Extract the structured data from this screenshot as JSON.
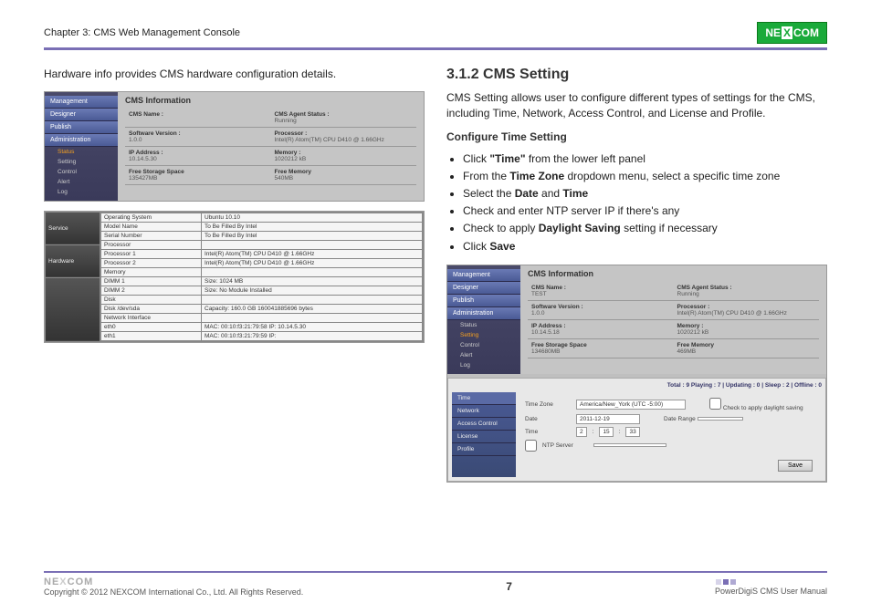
{
  "header": {
    "chapter": "Chapter 3: CMS Web Management Console",
    "logo": "NEXCOM"
  },
  "left": {
    "intro": "Hardware info provides CMS hardware configuration details.",
    "ss1": {
      "nav": [
        "Management",
        "Designer",
        "Publish",
        "Administration"
      ],
      "sub": [
        "Status",
        "Setting",
        "Control",
        "Alert",
        "Log"
      ],
      "title": "CMS Information",
      "info": [
        {
          "l": "CMS Name :",
          "v": ""
        },
        {
          "l": "CMS Agent Status :",
          "v": "Running"
        },
        {
          "l": "Software Version :",
          "v": "1.0.0"
        },
        {
          "l": "Processor :",
          "v": "Intel(R) Atom(TM) CPU D410 @ 1.66GHz"
        },
        {
          "l": "IP Address :",
          "v": "10.14.5.30"
        },
        {
          "l": "Memory :",
          "v": "1020212 kB"
        },
        {
          "l": "Free Storage Space",
          "v": "135427MB"
        },
        {
          "l": "Free Memory",
          "v": "540MB"
        }
      ],
      "hwTabs": [
        "Service",
        "Hardware"
      ],
      "hw": [
        [
          "Operating System",
          "Ubuntu 10.10"
        ],
        [
          "Model Name",
          "To Be Filled By Intel"
        ],
        [
          "Serial Number",
          "To Be Filled By Intel"
        ],
        [
          "Processor",
          ""
        ],
        [
          "Processor 1",
          "Intel(R) Atom(TM) CPU D410 @ 1.66GHz"
        ],
        [
          "Processor 2",
          "Intel(R) Atom(TM) CPU D410 @ 1.66GHz"
        ],
        [
          "Memory",
          ""
        ],
        [
          "DIMM 1",
          "Size: 1024 MB"
        ],
        [
          "DIMM 2",
          "Size: No Module Installed"
        ],
        [
          "Disk",
          ""
        ],
        [
          "Disk /dev/sda",
          "Capacity: 160.0 GB  160041885696 bytes"
        ],
        [
          "Network Interface",
          ""
        ],
        [
          "eth0",
          "MAC: 00:10:f3:21:79:58  IP: 10.14.5.30"
        ],
        [
          "eth1",
          "MAC: 00:10:f3:21:79:59  IP:"
        ]
      ]
    }
  },
  "right": {
    "h2": "3.1.2 CMS Setting",
    "para": "CMS Setting allows user to configure different types of settings for the CMS, including Time, Network, Access Control, and License and Profile.",
    "h3": "Configure Time Setting",
    "bullets": [
      {
        "pre": "Click ",
        "b": "\"Time\"",
        "post": " from the lower left panel"
      },
      {
        "pre": "From the ",
        "b": "Time Zone",
        "post": " dropdown menu, select a specific time zone"
      },
      {
        "pre": "Select the ",
        "b": "Date",
        "post": " and ",
        "b2": "Time"
      },
      {
        "pre": "Check and enter NTP server IP if there's any"
      },
      {
        "pre": "Check to apply ",
        "b": "Daylight Saving",
        "post": " setting if necessary"
      },
      {
        "pre": "Click ",
        "b": "Save"
      }
    ],
    "ss2": {
      "nav": [
        "Management",
        "Designer",
        "Publish",
        "Administration"
      ],
      "sub": [
        "Status",
        "Setting",
        "Control",
        "Alert",
        "Log"
      ],
      "title": "CMS Information",
      "info": [
        {
          "l": "CMS Name :",
          "v": "TEST"
        },
        {
          "l": "CMS Agent Status :",
          "v": "Running"
        },
        {
          "l": "Software Version :",
          "v": "1.0.0"
        },
        {
          "l": "Processor :",
          "v": "Intel(R) Atom(TM) CPU D410 @ 1.66GHz"
        },
        {
          "l": "IP Address :",
          "v": "10.14.5.18"
        },
        {
          "l": "Memory :",
          "v": "1020212 kB"
        },
        {
          "l": "Free Storage Space",
          "v": "134680MB"
        },
        {
          "l": "Free Memory",
          "v": "469MB"
        }
      ],
      "stats": "Total : 9   Playing : 7  |  Updating : 0  |  Sleep : 2  |  Offline : 0",
      "sideTabs": [
        "Time",
        "Network",
        "Access Control",
        "License",
        "Profile"
      ],
      "form": {
        "tzLabel": "Time Zone",
        "tz": "America/New_York (UTC -5:00)",
        "dateLabel": "Date",
        "date": "2011-12-19",
        "timeLabel": "Time",
        "h": "2",
        "m": "15",
        "s": "33",
        "ntpLabel": "NTP Server",
        "ntp": "",
        "dl": "Check to apply daylight saving",
        "drLabel": "Date Range",
        "save": "Save"
      }
    }
  },
  "footer": {
    "copyright": "Copyright © 2012 NEXCOM International Co., Ltd. All Rights Reserved.",
    "page": "7",
    "manual": "PowerDigiS CMS User Manual"
  }
}
